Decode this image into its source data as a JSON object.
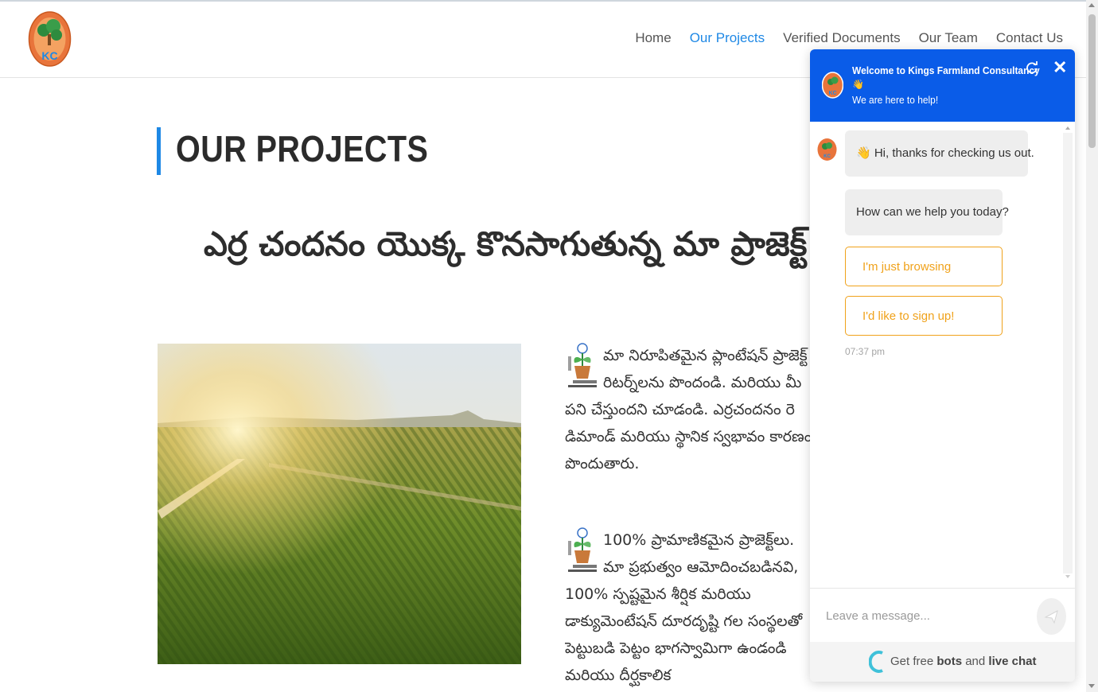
{
  "nav": {
    "items": [
      {
        "label": "Home"
      },
      {
        "label": "Our Projects"
      },
      {
        "label": "Verified Documents"
      },
      {
        "label": "Our Team"
      },
      {
        "label": "Contact Us"
      }
    ],
    "active_index": 1
  },
  "main": {
    "title": "OUR PROJECTS",
    "telugu_heading": "ఎర్ర చందనం యొక్క కొనసాగుతున్న మా ప్రాజెక్ట్",
    "paragraph_1": "మా నిరూపితమైన ప్లాంటేషన్ ప్రాజెక్ట్ రిటర్న్‌లను పొందండి. మరియు మీ పని చేస్తుందని చూడండి. ఎర్రచందనం రె డిమాండ్ మరియు స్థానిక స్వభావం కారణం పొందుతారు.",
    "paragraph_2": "100% ప్రామాణికమైన ప్రాజెక్ట్‌లు. మా ప్రభుత్వం ఆమోదించబడినవి, 100% స్పష్టమైన శీర్షిక మరియు డాక్యుమెంటేషన్ దూరదృష్టి గల సంస్థలతో పెట్టుబడి పెట్టం భాగస్వామిగా ఉండండి మరియు దీర్ఘకాలిక"
  },
  "chat": {
    "welcome": "Welcome to Kings Farmland Consultancy",
    "wave": "👋",
    "subtitle": "We are here to help!",
    "message_1": "👋 Hi, thanks for checking us out.",
    "message_2": "How can we help you today?",
    "options": [
      {
        "label": "I'm just browsing"
      },
      {
        "label": "I'd like to sign up!"
      }
    ],
    "time": "07:37 pm",
    "input_placeholder": "Leave a message...",
    "footer_prefix": "Get free",
    "footer_bots": "bots",
    "footer_and": "and",
    "footer_live": "live chat"
  },
  "colors": {
    "accent": "#1e88e5",
    "chat_header": "#0a5ce8",
    "option_orange": "#f0a21b"
  },
  "logo": {
    "text": "KC"
  }
}
